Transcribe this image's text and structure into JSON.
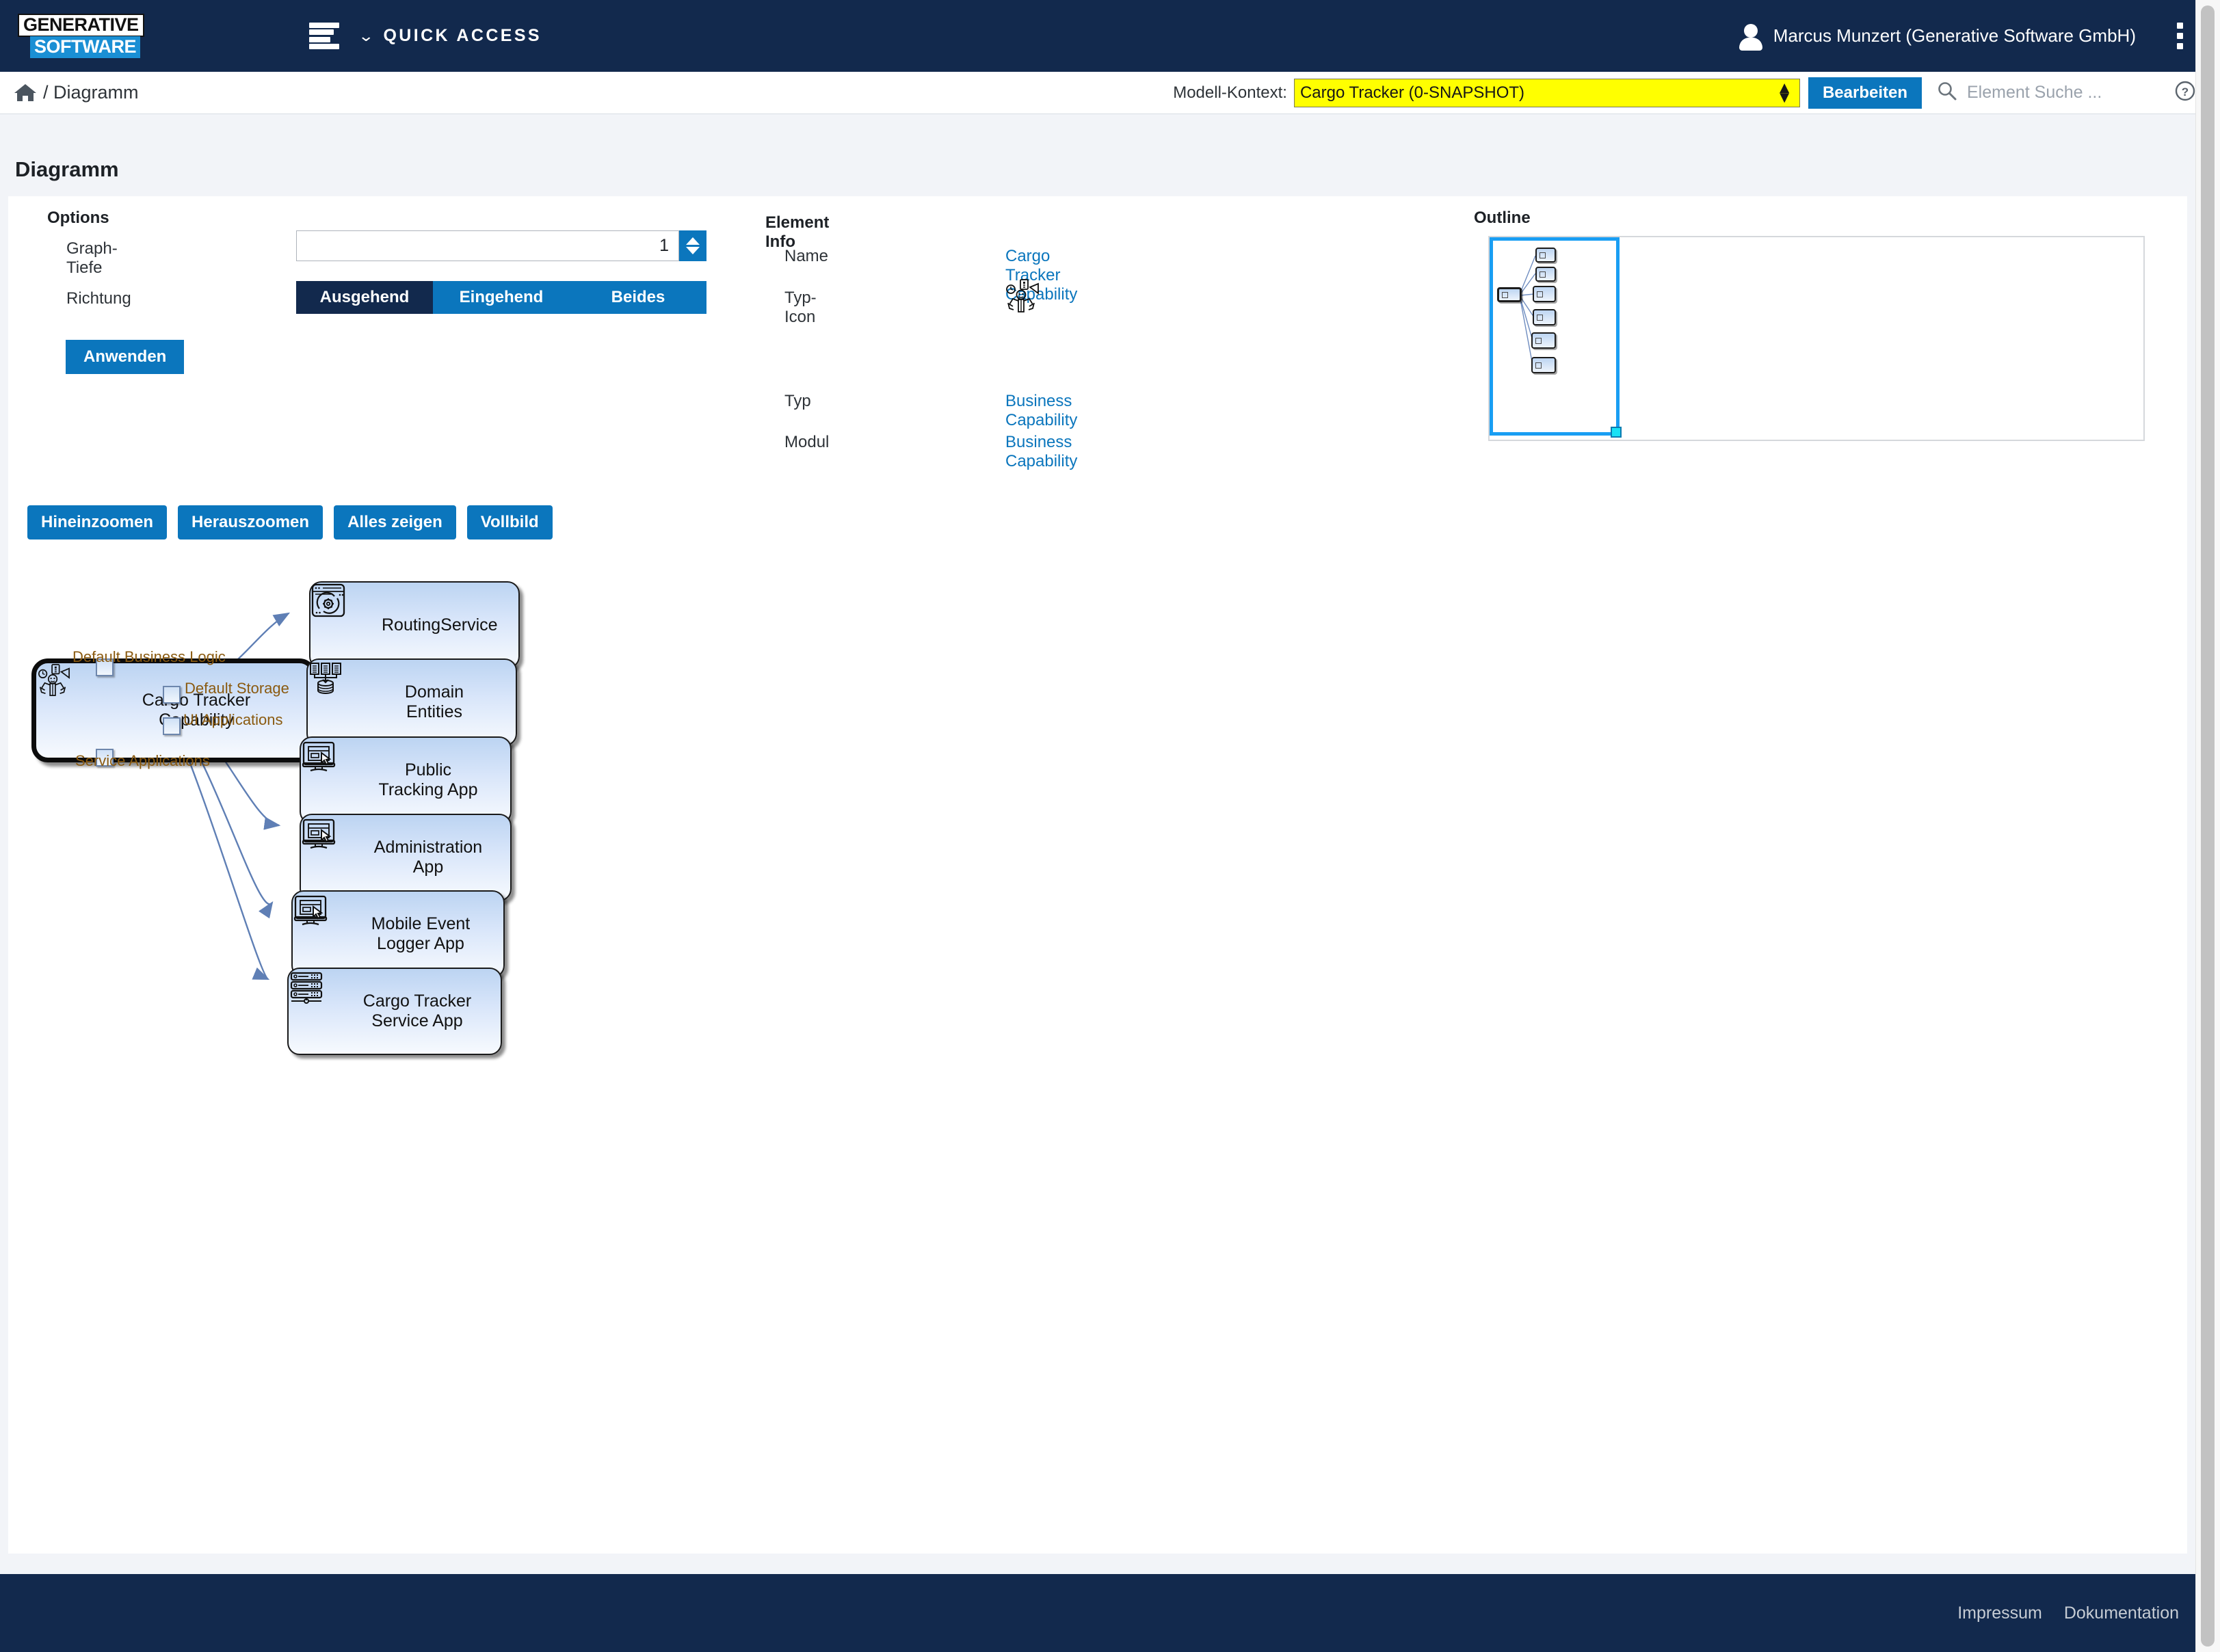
{
  "brand": {
    "line1": "GENERATIVE",
    "line2": "SOFTWARE"
  },
  "topnav": {
    "menu_icon": "hamburger-icon",
    "quick_access_label": "QUICK ACCESS",
    "quick_access_caret": "⌄",
    "user_name": "Marcus Munzert (Generative Software GmbH)",
    "overflow_icon": "kebab-menu-icon"
  },
  "contextbar": {
    "home_icon": "home-icon",
    "breadcrumb": "/ Diagramm",
    "model_context_label": "Modell-Kontext:",
    "model_context_value": "Cargo Tracker (0-SNAPSHOT)",
    "model_context_options": [
      "Cargo Tracker (0-SNAPSHOT)"
    ],
    "edit_button": "Bearbeiten",
    "search_icon": "search-icon",
    "search_placeholder": "Element Suche ...",
    "search_value": "",
    "help_icon": "help-circle-icon"
  },
  "page": {
    "title": "Diagramm"
  },
  "options": {
    "title": "Options",
    "depth_label": "Graph-Tiefe",
    "depth_value": "1",
    "direction_label": "Richtung",
    "direction_options": [
      "Ausgehend",
      "Eingehend",
      "Beides"
    ],
    "direction_selected": "Ausgehend",
    "apply_button": "Anwenden"
  },
  "element_info": {
    "title": "Element Info",
    "rows": [
      {
        "key": "Name",
        "value": "Cargo Tracker Capability"
      },
      {
        "key": "Typ-Icon",
        "value": "business-capability-icon"
      },
      {
        "key": "Typ",
        "value": "Business Capability"
      },
      {
        "key": "Modul",
        "value": "Business Capability"
      }
    ]
  },
  "outline": {
    "title": "Outline"
  },
  "zoom_toolbar": {
    "buttons": [
      "Hineinzoomen",
      "Herauszoomen",
      "Alles zeigen",
      "Vollbild"
    ]
  },
  "diagram": {
    "root": {
      "label": "Cargo Tracker Capability",
      "icon": "business-capability-icon",
      "ports": [
        {
          "name": "Default Business Logic",
          "side": "top"
        },
        {
          "name": "Default Storage",
          "side": "right"
        },
        {
          "name": "UI Applications",
          "side": "right"
        },
        {
          "name": "Service Applications",
          "side": "bottom"
        }
      ]
    },
    "nodes": [
      {
        "label": "RoutingService",
        "icon": "browser-gear-icon"
      },
      {
        "label": "Domain Entities",
        "icon": "documents-database-icon"
      },
      {
        "label": "Public Tracking App",
        "icon": "desktop-cursor-icon"
      },
      {
        "label": "Administration App",
        "icon": "desktop-cursor-icon"
      },
      {
        "label": "Mobile Event Logger App",
        "icon": "desktop-cursor-icon"
      },
      {
        "label": "Cargo Tracker Service App",
        "icon": "server-rack-icon"
      }
    ]
  },
  "footer": {
    "links": [
      "Impressum",
      "Dokumentation"
    ]
  },
  "colors": {
    "navy": "#12294d",
    "accent_blue": "#0b76bd",
    "highlight_yellow": "#ffff00",
    "link_blue": "#0b76bd",
    "port_label_brown": "#8a5a10"
  }
}
